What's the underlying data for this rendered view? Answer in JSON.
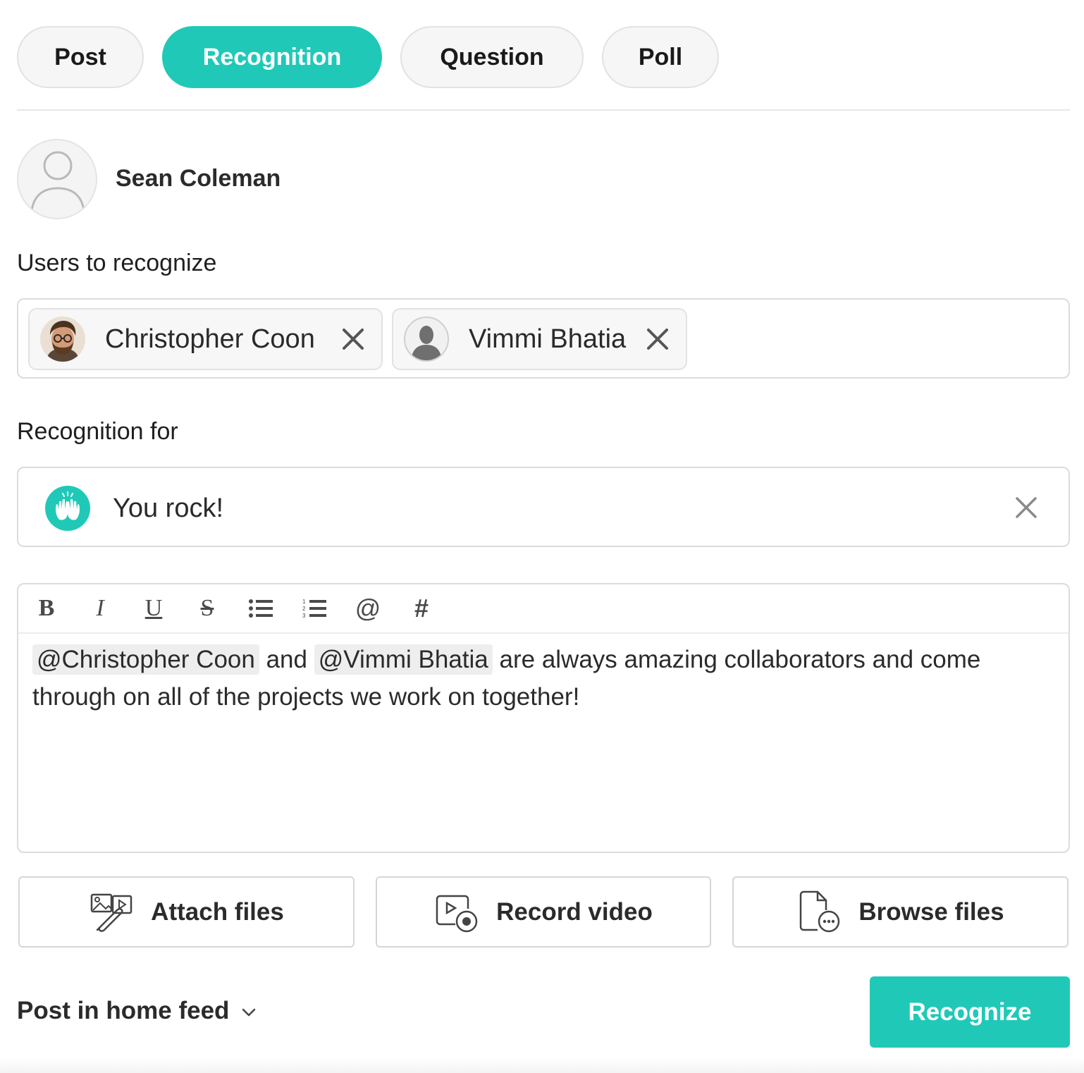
{
  "tabs": [
    {
      "label": "Post",
      "active": false
    },
    {
      "label": "Recognition",
      "active": true
    },
    {
      "label": "Question",
      "active": false
    },
    {
      "label": "Poll",
      "active": false
    }
  ],
  "author": {
    "name": "Sean Coleman",
    "avatar_icon": "default-user-icon"
  },
  "users_to_recognize": {
    "label": "Users to recognize",
    "chips": [
      {
        "name": "Christopher Coon",
        "avatar_icon": "user-photo-avatar"
      },
      {
        "name": "Vimmi Bhatia",
        "avatar_icon": "default-silhouette-avatar"
      }
    ]
  },
  "recognition_for": {
    "label": "Recognition for",
    "value": "You rock!",
    "badge_icon": "high-five-icon"
  },
  "editor": {
    "toolbar": {
      "bold": "B",
      "italic": "I",
      "underline": "U",
      "strikethrough": "S",
      "bulleted_list_icon": "bulleted-list-icon",
      "numbered_list_icon": "numbered-list-icon",
      "mention": "@",
      "hashtag": "#"
    },
    "body": {
      "mention_1": "@Christopher Coon",
      "text_1": " and ",
      "mention_2": "@Vimmi Bhatia",
      "text_2": " are always amazing collaborators and come through on all of the projects we work on together!"
    }
  },
  "actions": {
    "attach_files": "Attach files",
    "record_video": "Record video",
    "browse_files": "Browse files"
  },
  "footer": {
    "post_destination": "Post in home feed",
    "submit_label": "Recognize"
  },
  "colors": {
    "accent": "#20c9b7",
    "border": "#dcdcdc",
    "text": "#2b2b2b"
  }
}
